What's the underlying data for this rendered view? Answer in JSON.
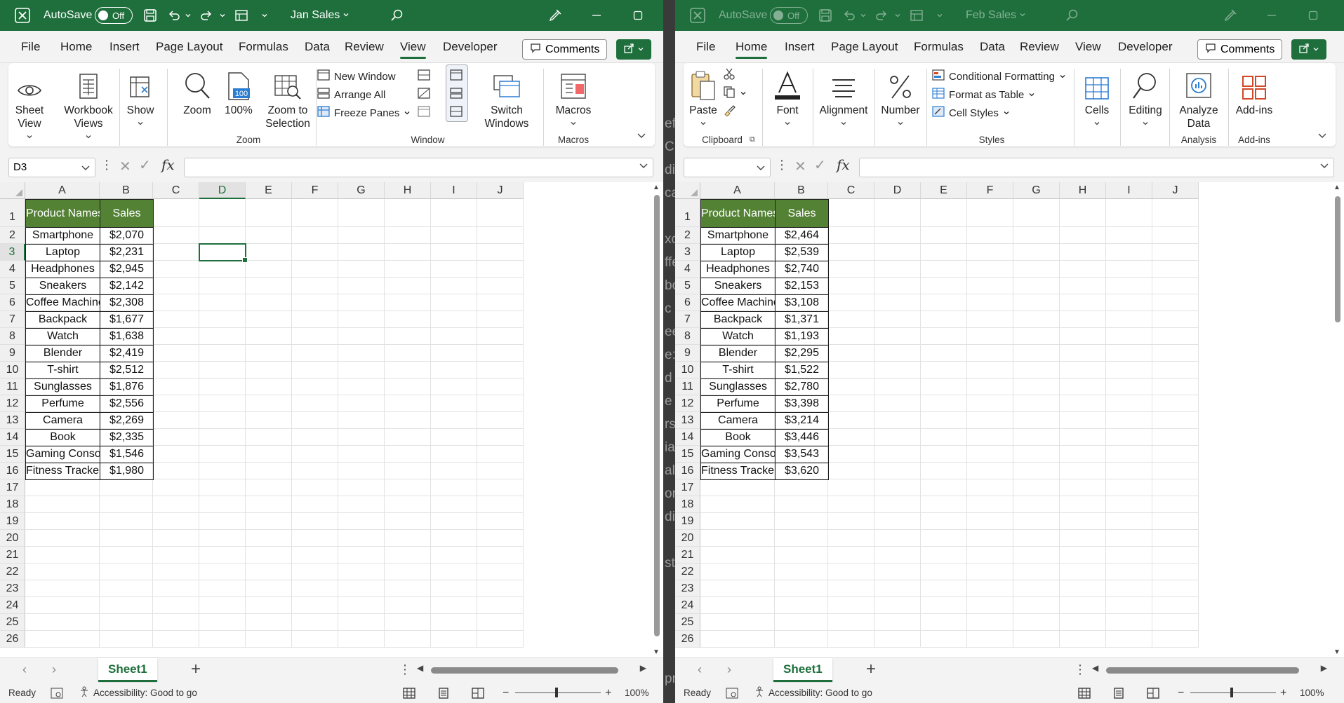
{
  "windows": [
    {
      "title": "Jan Sales",
      "autosave_label": "AutoSave",
      "autosave_state": "Off",
      "menu_tabs": [
        "File",
        "Home",
        "Insert",
        "Page Layout",
        "Formulas",
        "Data",
        "Review",
        "View",
        "Developer"
      ],
      "active_tab": "View",
      "comments_label": "Comments",
      "ribbon": {
        "sheet_view": "Sheet View",
        "workbook_views": "Workbook Views",
        "show": "Show",
        "zoom": "Zoom",
        "zoom100": "100%",
        "zoom_badge": "100",
        "zoom_to_selection": "Zoom to Selection",
        "zoom_group": "Zoom",
        "new_window": "New Window",
        "arrange_all": "Arrange All",
        "freeze_panes": "Freeze Panes",
        "window_group": "Window",
        "switch_windows": "Switch Windows",
        "macros": "Macros",
        "macros_group": "Macros"
      },
      "name_box": "D3",
      "fx_label": "fx",
      "sheet_name": "Sheet1",
      "status": "Ready",
      "accessibility": "Accessibility: Good to go",
      "zoom_level": "100%",
      "headers": [
        "Product Names",
        "Sales"
      ],
      "rows": [
        [
          "Smartphone",
          "$2,070"
        ],
        [
          "Laptop",
          "$2,231"
        ],
        [
          "Headphones",
          "$2,945"
        ],
        [
          "Sneakers",
          "$2,142"
        ],
        [
          "Coffee Machine",
          "$2,308"
        ],
        [
          "Backpack",
          "$1,677"
        ],
        [
          "Watch",
          "$1,638"
        ],
        [
          "Blender",
          "$2,419"
        ],
        [
          "T-shirt",
          "$2,512"
        ],
        [
          "Sunglasses",
          "$1,876"
        ],
        [
          "Perfume",
          "$2,556"
        ],
        [
          "Camera",
          "$2,269"
        ],
        [
          "Book",
          "$2,335"
        ],
        [
          "Gaming Console",
          "$1,546"
        ],
        [
          "Fitness Tracker",
          "$1,980"
        ]
      ]
    },
    {
      "title": "Feb Sales",
      "autosave_label": "AutoSave",
      "autosave_state": "Off",
      "menu_tabs": [
        "File",
        "Home",
        "Insert",
        "Page Layout",
        "Formulas",
        "Data",
        "Review",
        "View",
        "Developer"
      ],
      "active_tab": "Home",
      "comments_label": "Comments",
      "ribbon": {
        "paste": "Paste",
        "clipboard_group": "Clipboard",
        "font": "Font",
        "alignment": "Alignment",
        "number": "Number",
        "conditional_formatting": "Conditional Formatting",
        "format_as_table": "Format as Table",
        "cell_styles": "Cell Styles",
        "styles_group": "Styles",
        "cells": "Cells",
        "editing": "Editing",
        "analyze_data": "Analyze Data",
        "analysis_group": "Analysis",
        "add_ins": "Add-ins",
        "addins_group": "Add-ins"
      },
      "name_box": "",
      "fx_label": "fx",
      "sheet_name": "Sheet1",
      "status": "Ready",
      "accessibility": "Accessibility: Good to go",
      "zoom_level": "100%",
      "headers": [
        "Product Names",
        "Sales"
      ],
      "rows": [
        [
          "Smartphone",
          "$2,464"
        ],
        [
          "Laptop",
          "$2,539"
        ],
        [
          "Headphones",
          "$2,740"
        ],
        [
          "Sneakers",
          "$2,153"
        ],
        [
          "Coffee Machine",
          "$3,108"
        ],
        [
          "Backpack",
          "$1,371"
        ],
        [
          "Watch",
          "$1,193"
        ],
        [
          "Blender",
          "$2,295"
        ],
        [
          "T-shirt",
          "$1,522"
        ],
        [
          "Sunglasses",
          "$2,780"
        ],
        [
          "Perfume",
          "$3,398"
        ],
        [
          "Camera",
          "$3,214"
        ],
        [
          "Book",
          "$3,446"
        ],
        [
          "Gaming Console",
          "$3,543"
        ],
        [
          "Fitness Tracker",
          "$3,620"
        ]
      ]
    }
  ],
  "column_letters": [
    "A",
    "B",
    "C",
    "D",
    "E",
    "F",
    "G",
    "H",
    "I",
    "J"
  ],
  "row_count": 26,
  "background_snippets": [
    "efu",
    "CH",
    "dis",
    "ca",
    "",
    "xc",
    "ffe",
    "bo",
    "c",
    "ee",
    "e:",
    "d",
    "e f",
    "rs",
    "iab",
    "all",
    "or",
    "dis",
    "",
    "st",
    "",
    "",
    "",
    "",
    "pre"
  ],
  "colors": {
    "excel_green": "#1e6f3c",
    "header_fill": "#548235"
  }
}
